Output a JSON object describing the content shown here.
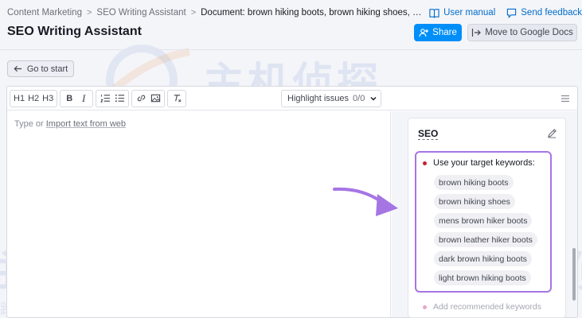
{
  "breadcrumb": {
    "items": [
      "Content Marketing",
      "SEO Writing Assistant"
    ],
    "current": "Document: brown hiking boots, brown hiking shoes, me..."
  },
  "header_links": {
    "user_manual": "User manual",
    "send_feedback": "Send feedback"
  },
  "page": {
    "title": "SEO Writing Assistant",
    "share_label": "Share",
    "move_label": "Move to Google Docs",
    "back_label": "Go to start"
  },
  "toolbar": {
    "h1": "H1",
    "h2": "H2",
    "h3": "H3",
    "bold": "B",
    "italic": "I",
    "highlight_label": "Highlight issues",
    "highlight_count": "0/0"
  },
  "editor": {
    "placeholder_prefix": "Type or",
    "placeholder_link": "Import text from web"
  },
  "seo_panel": {
    "title": "SEO",
    "keywords_heading": "Use your target keywords:",
    "keywords": [
      "brown hiking boots",
      "brown hiking shoes",
      "mens brown hiker boots",
      "brown leather hiker boots",
      "dark brown hiking boots",
      "light brown hiking boots"
    ],
    "next_item": "Add recommended keywords",
    "highlight_color": "#a675e4"
  },
  "watermark": {
    "big_text": "主机侦探",
    "small_text": "服务跨境电商 助力中企出海",
    "small_text_lower": "跨境电商 助力中企出海",
    "small_text_right": "跨境电"
  },
  "colors": {
    "accent": "#008ff8",
    "link": "#006dca",
    "keyword_dot": "#c81f2f"
  },
  "icons": {
    "user_manual": "book-icon",
    "send_feedback": "chat-bubble-icon",
    "share": "add-user-icon",
    "move": "export-icon",
    "back": "arrow-left-icon",
    "edit": "pencil-icon",
    "menu": "hamburger-icon"
  }
}
